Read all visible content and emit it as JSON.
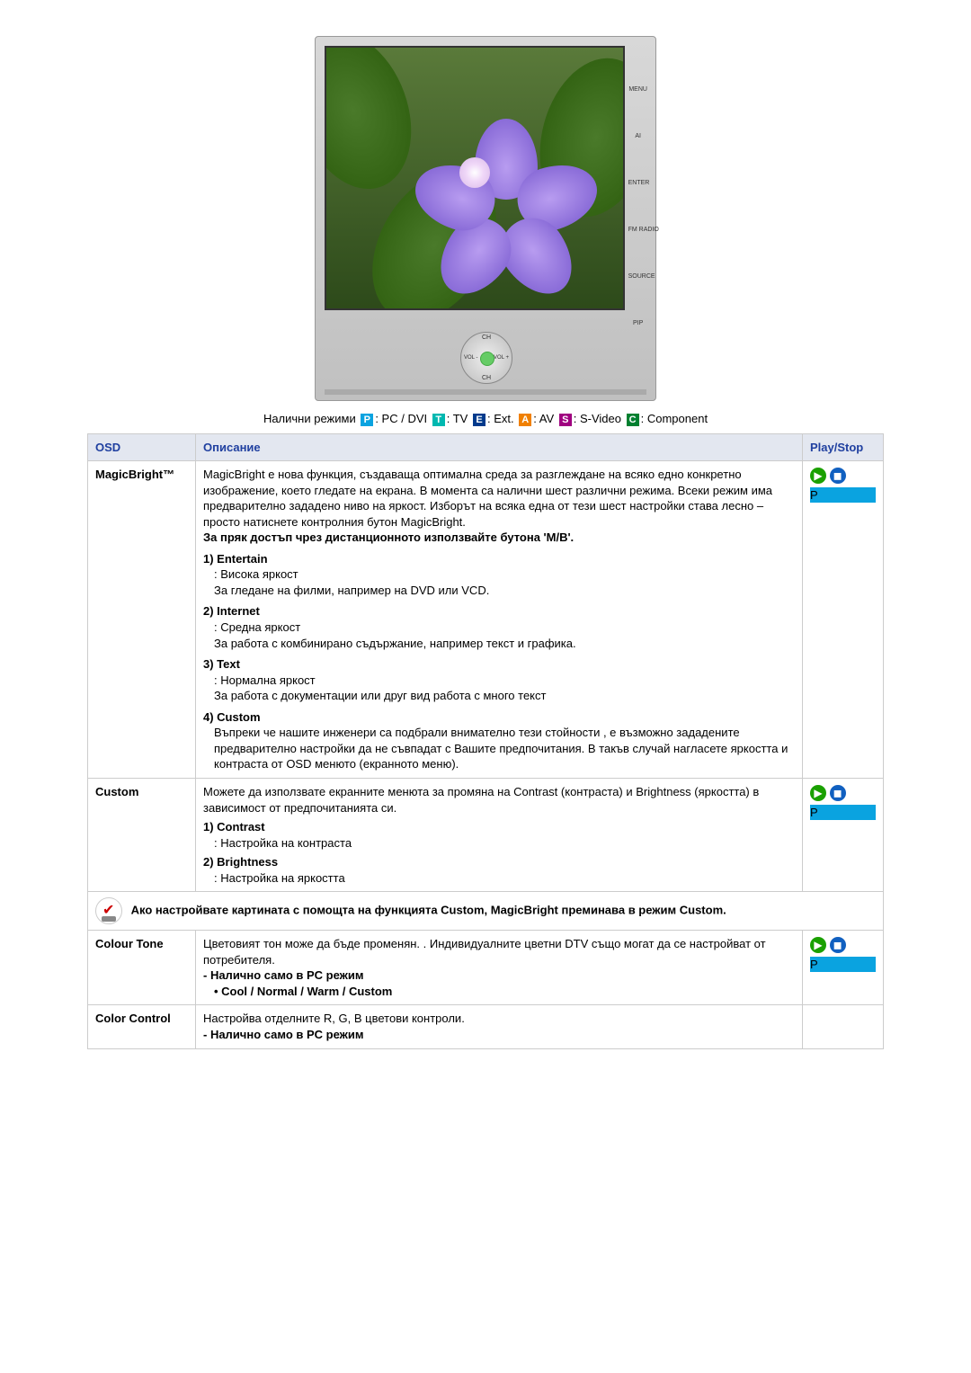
{
  "modes_line": {
    "prefix": "Налични режими",
    "items": [
      {
        "chip": "P",
        "label": ": PC / DVI"
      },
      {
        "chip": "T",
        "label": ": TV"
      },
      {
        "chip": "E",
        "label": ": Ext."
      },
      {
        "chip": "A",
        "label": ": AV"
      },
      {
        "chip": "S",
        "label": ": S-Video"
      },
      {
        "chip": "C",
        "label": ": Component"
      }
    ]
  },
  "header": {
    "osd": "OSD",
    "desc": "Описание",
    "play": "Play/Stop"
  },
  "tv": {
    "side": [
      "MENU",
      "AI",
      "ENTER",
      "FM RADIO",
      "SOURCE",
      "PIP"
    ],
    "dial": {
      "up": "CH",
      "down": "CH",
      "left": "VOL -",
      "right": "VOL +"
    }
  },
  "rows": {
    "magicbright": {
      "name": "MagicBright™",
      "intro": "MagicBright е нова функция, създаваща оптимална среда за разглеждане на всяко едно конкретно изображение, което гледате на екрана. В момента са налични шест различни режима. Всеки режим има предварително зададено ниво на яркост. Изборът на всяка една от тези шест настройки става лесно – просто натиснете контролния бутон MagicBright.",
      "direct": "За пряк достъп чрез дистанционното използвайте бутона 'M/B'.",
      "opt1_h": "1) Entertain",
      "opt1_a": ": Висока яркост",
      "opt1_b": "За гледане на филми, например на DVD или VCD.",
      "opt2_h": "2) Internet",
      "opt2_a": ": Средна яркост",
      "opt2_b": "За работа с комбинирано съдържание, например текст и графика.",
      "opt3_h": "3) Text",
      "opt3_a": ": Нормална яркост",
      "opt3_b": "За работа с документации или друг вид работа с много текст",
      "opt4_h": "4) Custom",
      "opt4_a": "Въпреки че нашите инженери са подбрали внимателно тези стойности , е възможно зададените предварително настройки да не съвпадат с Вашите предпочитания. В такъв случай нагласете яркостта и контраста от OSD менюто (екранното меню)."
    },
    "custom": {
      "name": "Custom",
      "intro": "Можете да използвате екранните менюта за промяна на Contrast (контраста) и Brightness (яркостта) в зависимост от предпочитанията си.",
      "opt1_h": "1) Contrast",
      "opt1_a": ": Настройка на контраста",
      "opt2_h": "2) Brightness",
      "opt2_a": ": Настройка на яркостта"
    },
    "note": {
      "text": "Ако настройвате картината с помощта на функцията Custom, MagicBright преминава в режим Custom."
    },
    "colourtone": {
      "name": "Colour Tone",
      "intro": "Цветовият тон може да бъде променян. . Индивидуалните цветни DTV също могат да се настройват от потребителя.",
      "line2": "- Налично само в PC режим",
      "line3": "• Cool / Normal / Warm / Custom"
    },
    "colorcontrol": {
      "name": "Color Control",
      "intro": "Настройва отделните R, G, B цветови контроли.",
      "line2": "- Налично само в PC режим"
    }
  },
  "chips": {
    "P": "P",
    "T": "T",
    "E": "E",
    "A": "A",
    "S": "S",
    "C": "C"
  },
  "play": {
    "play": "▶",
    "stop": "◼"
  }
}
